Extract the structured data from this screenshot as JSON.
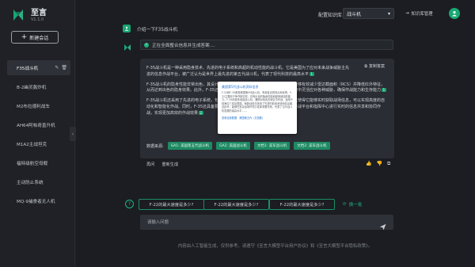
{
  "app": {
    "title": "至言",
    "version": "V1.1.0"
  },
  "sidebar": {
    "new_chat_label": "新建会话",
    "items": [
      {
        "label": "F35战斗机",
        "active": true
      },
      {
        "label": "B-2幽灵轰炸机"
      },
      {
        "label": "M2布拉德利战车"
      },
      {
        "label": "AH64阿帕奇直升机"
      },
      {
        "label": "M1A2主战坦克"
      },
      {
        "label": "福特级航空母舰"
      },
      {
        "label": "主动防止系统"
      },
      {
        "label": "MQ-9捕食者无人机"
      }
    ]
  },
  "header": {
    "kb_label": "配置知识库",
    "kb_selected": "战斗机",
    "kb_manage_label": "知识库管理"
  },
  "chat": {
    "user_message": "介绍一下F35战斗机",
    "status_text": "正在全面整合信息并生成答案....",
    "copy_label": "复制答案",
    "paragraphs": [
      {
        "text": "F-35战斗机是一种采用隐身技术、先进的电子系统和高超的机动性能的战斗机。它是美国为了应对未来战争威胁主先进的信息作战平台，被广泛认为是世界上最先进的第五代战斗机，代表了现代科技的最高水平",
        "cite": "1"
      },
      {
        "text": "F-35战斗机的隐身性能非常出色，其设计采用了先进的隐身材料和复杂的外形设计，能够有效减少雷达截面积（RCS）并降低红外特征，从而达到出色的隐身效果。此外，F-35还具备出色的机动性能，能够在复杂的战场环境中灵活应对各种威胁，确保作战能力和生存能力",
        "cite": "1"
      },
      {
        "text": "F-35战斗机还采用了先进的电子系统，包括先进的传感器、雷达系统和数据链路等，这使得它能够实时获取战场信息，可以实现高度的自动化和智能化作战。同时，F-35还具备要强的网络化和信息化作战能力，可以与其他作战平台和指挥中心进行实时的信息共享和协同作战，实现更加高效的作战效果",
        "cite": "2"
      }
    ],
    "sources_label": "数据来源:",
    "sources": [
      "GA1: 美国第五代战斗机",
      "GA2: 美国战斗机",
      "文档1: 美军战斗机",
      "文档2: 美军战斗机"
    ],
    "popup": {
      "title": "美国第5代战斗机资料信息",
      "body": "F-22和F-35都是美国第5代战斗机，有着各自的特点和优势，F-22主要用于争夺制空权，具有出色的隐身性能和超音速巡航能力；F-35则是多用途战斗机，兼顾对地攻击和空中作战，适用于陆海空三军及盟国。两款战机均采用了先进的航电系统和信息融合技术，能够在复杂战场环境中发挥重要作用，代表了当今战斗机发展的最高水平……",
      "footer": "查看全部数据：美国第五代（文档数）"
    },
    "links": {
      "regenerate": "再问",
      "regenerate2": "重新生成"
    },
    "feedback": {
      "like": "👍",
      "dislike": "👎",
      "copy": "⧉"
    }
  },
  "suggestions": {
    "items": [
      "F-22的最大速度是多少?",
      "F-22的最大速度是多少?",
      "F-22的最大速度是多少?"
    ],
    "refresh_label": "换一批"
  },
  "input": {
    "placeholder": "请输入问题"
  },
  "footer_note": "内容由人工智能生成，仅供参考。请遵守《至言大模型平台用户协议》和《至言大模型平台隐私政策》。",
  "colors": {
    "accent": "#1aa574",
    "background": "#1b1d22",
    "panel": "#2a2d33"
  },
  "icons": [
    "logo-icon",
    "plus-icon",
    "edit-icon",
    "delete-icon",
    "collapse-icon",
    "chevron-down-icon",
    "kb-manage-icon",
    "avatar-icon",
    "user-icon",
    "bot-icon",
    "check-icon",
    "copy-icon",
    "thumbs-up-icon",
    "thumbs-down-icon",
    "question-icon",
    "refresh-icon",
    "send-icon"
  ]
}
